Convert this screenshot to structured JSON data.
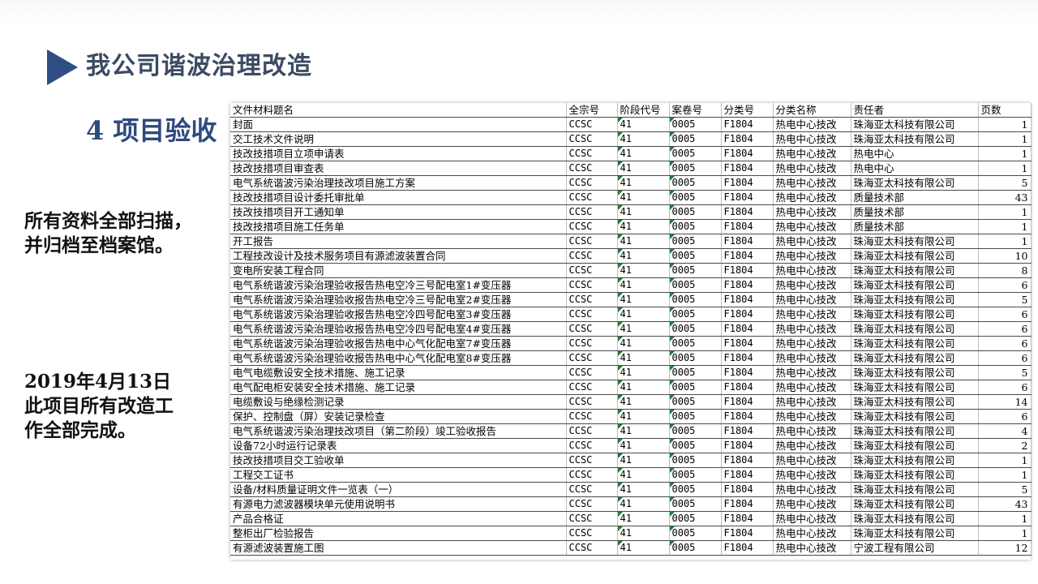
{
  "slide": {
    "title": "我公司谐波治理改造",
    "section_title": "4 项目验收",
    "note1": [
      "所有资料全部扫描，",
      "并归档至档案馆。"
    ],
    "note2": [
      "2019年4月13日",
      "此项目所有改造工",
      "作全部完成。"
    ],
    "accent_color": "#2f4f84"
  },
  "table": {
    "headers": [
      "文件材料题名",
      "全宗号",
      "阶段代号",
      "案卷号",
      "分类号",
      "分类名称",
      "责任者",
      "页数"
    ],
    "rows": [
      [
        "封面",
        "CCSC",
        "41",
        "0005",
        "F1804",
        "热电中心技改",
        "珠海亚太科技有限公司",
        "1"
      ],
      [
        "交工技术文件说明",
        "CCSC",
        "41",
        "0005",
        "F1804",
        "热电中心技改",
        "珠海亚太科技有限公司",
        "1"
      ],
      [
        "技改技措项目立项申请表",
        "CCSC",
        "41",
        "0005",
        "F1804",
        "热电中心技改",
        "热电中心",
        "1"
      ],
      [
        "技改技措项目审查表",
        "CCSC",
        "41",
        "0005",
        "F1804",
        "热电中心技改",
        "热电中心",
        "1"
      ],
      [
        "电气系统谐波污染治理技改项目施工方案",
        "CCSC",
        "41",
        "0005",
        "F1804",
        "热电中心技改",
        "珠海亚太科技有限公司",
        "5"
      ],
      [
        "技改技措项目设计委托审批单",
        "CCSC",
        "41",
        "0005",
        "F1804",
        "热电中心技改",
        "质量技术部",
        "43"
      ],
      [
        "技改技措项目开工通知单",
        "CCSC",
        "41",
        "0005",
        "F1804",
        "热电中心技改",
        "质量技术部",
        "1"
      ],
      [
        "技改技措项目施工任务单",
        "CCSC",
        "41",
        "0005",
        "F1804",
        "热电中心技改",
        "质量技术部",
        "1"
      ],
      [
        "开工报告",
        "CCSC",
        "41",
        "0005",
        "F1804",
        "热电中心技改",
        "珠海亚太科技有限公司",
        "1"
      ],
      [
        "工程技改设计及技术服务项目有源滤波装置合同",
        "CCSC",
        "41",
        "0005",
        "F1804",
        "热电中心技改",
        "珠海亚太科技有限公司",
        "10"
      ],
      [
        "变电所安装工程合同",
        "CCSC",
        "41",
        "0005",
        "F1804",
        "热电中心技改",
        "珠海亚太科技有限公司",
        "8"
      ],
      [
        "电气系统谐波污染治理验收报告热电空冷三号配电室1#变压器",
        "CCSC",
        "41",
        "0005",
        "F1804",
        "热电中心技改",
        "珠海亚太科技有限公司",
        "6"
      ],
      [
        "电气系统谐波污染治理验收报告热电空冷三号配电室2#变压器",
        "CCSC",
        "41",
        "0005",
        "F1804",
        "热电中心技改",
        "珠海亚太科技有限公司",
        "5"
      ],
      [
        "电气系统谐波污染治理验收报告热电空冷四号配电室3#变压器",
        "CCSC",
        "41",
        "0005",
        "F1804",
        "热电中心技改",
        "珠海亚太科技有限公司",
        "6"
      ],
      [
        "电气系统谐波污染治理验收报告热电空冷四号配电室4#变压器",
        "CCSC",
        "41",
        "0005",
        "F1804",
        "热电中心技改",
        "珠海亚太科技有限公司",
        "6"
      ],
      [
        "电气系统谐波污染治理验收报告热电中心气化配电室7#变压器",
        "CCSC",
        "41",
        "0005",
        "F1804",
        "热电中心技改",
        "珠海亚太科技有限公司",
        "6"
      ],
      [
        "电气系统谐波污染治理验收报告热电中心气化配电室8#变压器",
        "CCSC",
        "41",
        "0005",
        "F1804",
        "热电中心技改",
        "珠海亚太科技有限公司",
        "6"
      ],
      [
        "电气电缆敷设安全技术措施、施工记录",
        "CCSC",
        "41",
        "0005",
        "F1804",
        "热电中心技改",
        "珠海亚太科技有限公司",
        "5"
      ],
      [
        "电气配电柜安装安全技术措施、施工记录",
        "CCSC",
        "41",
        "0005",
        "F1804",
        "热电中心技改",
        "珠海亚太科技有限公司",
        "6"
      ],
      [
        "电缆敷设与绝缘检测记录",
        "CCSC",
        "41",
        "0005",
        "F1804",
        "热电中心技改",
        "珠海亚太科技有限公司",
        "14"
      ],
      [
        "保护、控制盘（屏）安装记录检查",
        "CCSC",
        "41",
        "0005",
        "F1804",
        "热电中心技改",
        "珠海亚太科技有限公司",
        "6"
      ],
      [
        "电气系统谐波污染治理技改项目（第二阶段）竣工验收报告",
        "CCSC",
        "41",
        "0005",
        "F1804",
        "热电中心技改",
        "珠海亚太科技有限公司",
        "4"
      ],
      [
        "设备72小时运行记录表",
        "CCSC",
        "41",
        "0005",
        "F1804",
        "热电中心技改",
        "珠海亚太科技有限公司",
        "2"
      ],
      [
        "技改技措项目交工验收单",
        "CCSC",
        "41",
        "0005",
        "F1804",
        "热电中心技改",
        "珠海亚太科技有限公司",
        "1"
      ],
      [
        "工程交工证书",
        "CCSC",
        "41",
        "0005",
        "F1804",
        "热电中心技改",
        "珠海亚太科技有限公司",
        "1"
      ],
      [
        "设备/材料质量证明文件一览表（一）",
        "CCSC",
        "41",
        "0005",
        "F1804",
        "热电中心技改",
        "珠海亚太科技有限公司",
        "5"
      ],
      [
        "有源电力滤波器模块单元使用说明书",
        "CCSC",
        "41",
        "0005",
        "F1804",
        "热电中心技改",
        "珠海亚太科技有限公司",
        "43"
      ],
      [
        "产品合格证",
        "CCSC",
        "41",
        "0005",
        "F1804",
        "热电中心技改",
        "珠海亚太科技有限公司",
        "1"
      ],
      [
        "整柜出厂检验报告",
        "CCSC",
        "41",
        "0005",
        "F1804",
        "热电中心技改",
        "珠海亚太科技有限公司",
        "1"
      ],
      [
        "有源滤波装置施工图",
        "CCSC",
        "41",
        "0005",
        "F1804",
        "热电中心技改",
        "宁波工程有限公司",
        "12"
      ]
    ]
  }
}
